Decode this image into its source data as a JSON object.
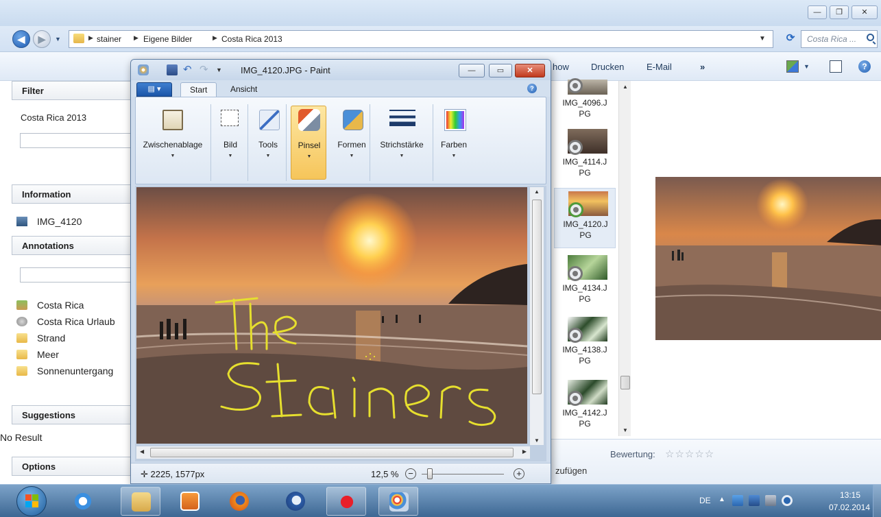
{
  "explorer": {
    "breadcrumb": [
      "stainer",
      "Eigene Bilder",
      "Costa Rica 2013"
    ],
    "search_placeholder": "Costa Rica ...",
    "toolbar": {
      "slideshow_partial": "how",
      "print": "Drucken",
      "email": "E-Mail",
      "more": "»"
    },
    "left_pane": {
      "filter_header": "Filter",
      "filter_value": "Costa Rica 2013",
      "information_header": "Information",
      "information_item": "IMG_4120",
      "annotations_header": "Annotations",
      "tags": [
        "Costa Rica",
        "Costa Rica Urlaub",
        "Strand",
        "Meer",
        "Sonnenuntergang"
      ],
      "suggestions_header": "Suggestions",
      "suggestions_value": "No Result",
      "options_header": "Options"
    },
    "files": [
      {
        "name": "IMG_4096.JPG",
        "line1": "IMG_4096.J",
        "line2": "PG"
      },
      {
        "name": "IMG_4114.JPG",
        "line1": "IMG_4114.J",
        "line2": "PG"
      },
      {
        "name": "IMG_4120.JPG",
        "line1": "IMG_4120.J",
        "line2": "PG",
        "selected": true
      },
      {
        "name": "IMG_4134.JPG",
        "line1": "IMG_4134.J",
        "line2": "PG"
      },
      {
        "name": "IMG_4138.JPG",
        "line1": "IMG_4138.J",
        "line2": "PG"
      },
      {
        "name": "IMG_4142.JPG",
        "line1": "IMG_4142.J",
        "line2": "PG"
      }
    ],
    "details": {
      "rating_label": "Bewertung:",
      "stars": "☆☆☆☆☆",
      "add_tag_partial": "zufügen"
    }
  },
  "paint": {
    "title": "IMG_4120.JPG - Paint",
    "tabs": [
      "Start",
      "Ansicht"
    ],
    "active_tab": "Start",
    "help": "?",
    "ribbon": [
      {
        "label": "Zwischenablage",
        "icon": "clipboard-icon"
      },
      {
        "label": "Bild",
        "icon": "select-icon"
      },
      {
        "label": "Tools",
        "icon": "tools-icon"
      },
      {
        "label": "Pinsel",
        "icon": "brush-icon",
        "active": true
      },
      {
        "label": "Formen",
        "icon": "shapes-icon"
      },
      {
        "label": "Strichstärke",
        "icon": "line-width-icon"
      },
      {
        "label": "Farben",
        "icon": "colors-icon"
      }
    ],
    "canvas_text": "The Stainers",
    "status": {
      "cursor_pos": "2225, 1577px",
      "zoom": "12,5 %"
    }
  },
  "taskbar": {
    "apps": [
      "internet-explorer",
      "windows-explorer",
      "media-player",
      "firefox",
      "thunderbird",
      "red-splat-app",
      "paint"
    ],
    "tray_lang": "DE",
    "time": "13:15",
    "date": "07.02.2014"
  },
  "colors": {
    "accent": "#1c56a8",
    "highlight": "#f6c55a",
    "sunset": "#e07a3a"
  }
}
